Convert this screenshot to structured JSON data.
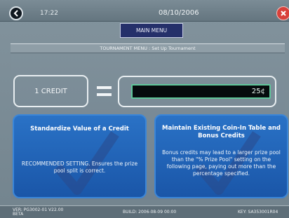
{
  "header": {
    "time": "17:22",
    "date": "08/10/2006"
  },
  "main_menu_label": "MAIN MENU",
  "breadcrumb": "TOURNAMENT MENU : Set Up Tournament",
  "credit": {
    "label": "1 CREDIT",
    "value": "25¢"
  },
  "options": [
    {
      "title": "Standardize Value of a Credit",
      "description": "RECOMMENDED SETTING. Ensures the prize pool split is correct."
    },
    {
      "title": "Maintain Existing Coin-In Table and Bonus Credits",
      "description": "Bonus credits may lead to a larger prize pool than the \"% Prize Pool\" setting on the following page, paying out more than the percentage specified."
    }
  ],
  "footer": {
    "version_line1": "VER: PG3002-01 V22.00",
    "version_line2": "BETA",
    "build": "BUILD: 2006-08-09 00:00",
    "key": "KEY: SA353001R04"
  },
  "icons": {
    "back": "back-arrow-icon",
    "close": "close-icon",
    "check": "checkmark-icon"
  },
  "colors": {
    "option_blue": "#1f62b6",
    "close_red": "#d8403a",
    "value_green": "#5fc79a"
  }
}
